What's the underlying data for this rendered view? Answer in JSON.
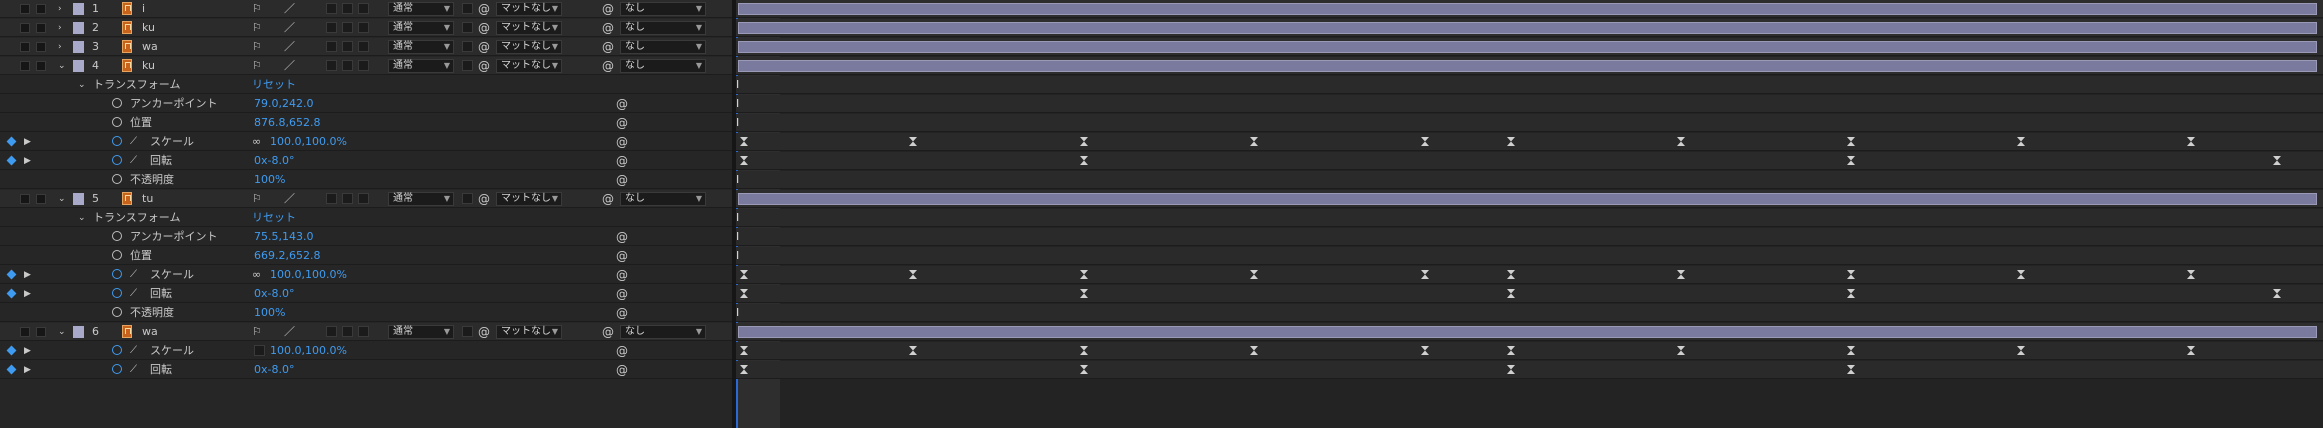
{
  "layers": [
    {
      "num": "1",
      "name": "i",
      "mode": "通常",
      "matte": "マットなし",
      "parent": "なし",
      "expanded": false
    },
    {
      "num": "2",
      "name": "ku",
      "mode": "通常",
      "matte": "マットなし",
      "parent": "なし",
      "expanded": false
    },
    {
      "num": "3",
      "name": "wa",
      "mode": "通常",
      "matte": "マットなし",
      "parent": "なし",
      "expanded": false
    },
    {
      "num": "4",
      "name": "ku",
      "mode": "通常",
      "matte": "マットなし",
      "parent": "なし",
      "expanded": true
    },
    {
      "num": "5",
      "name": "tu",
      "mode": "通常",
      "matte": "マットなし",
      "parent": "なし",
      "expanded": true
    },
    {
      "num": "6",
      "name": "wa",
      "mode": "通常",
      "matte": "マットなし",
      "parent": "なし",
      "expanded": true
    }
  ],
  "transform_label": "トランスフォーム",
  "reset_label": "リセット",
  "props4": [
    {
      "label": "アンカーポイント",
      "value": "79.0,242.0",
      "keyed": false
    },
    {
      "label": "位置",
      "value": "876.8,652.8",
      "keyed": false
    },
    {
      "label": "スケール",
      "value": "100.0,100.0%",
      "keyed": true,
      "link": true
    },
    {
      "label": "回転",
      "value": "0x-8.0°",
      "keyed": true
    },
    {
      "label": "不透明度",
      "value": "100%",
      "keyed": false
    }
  ],
  "props5": [
    {
      "label": "アンカーポイント",
      "value": "75.5,143.0",
      "keyed": false
    },
    {
      "label": "位置",
      "value": "669.2,652.8",
      "keyed": false
    },
    {
      "label": "スケール",
      "value": "100.0,100.0%",
      "keyed": true,
      "link": true
    },
    {
      "label": "回転",
      "value": "0x-8.0°",
      "keyed": true
    },
    {
      "label": "不透明度",
      "value": "100%",
      "keyed": false
    }
  ],
  "props6": [
    {
      "label": "スケール",
      "value": "100.0,100.0%",
      "keyed": true,
      "link": false
    },
    {
      "label": "回転",
      "value": "0x-8.0°",
      "keyed": true
    }
  ],
  "timeline": {
    "scale_keys": [
      0,
      0.11,
      0.222,
      0.333,
      0.444,
      0.5,
      0.611,
      0.722,
      0.833,
      0.944
    ],
    "rotation_keys4": [
      0,
      0.222,
      0.722,
      1.0
    ],
    "rotation_keys5": [
      0,
      0.222,
      0.5,
      0.722,
      1.0
    ],
    "rotation_keys6": [
      0,
      0.222,
      0.5,
      0.722
    ]
  },
  "colors": {
    "accent": "#3f9bf0",
    "bar": "#7a7a9e",
    "label_chip": "#a9a9c9",
    "layer_icon": "#c8631b"
  }
}
